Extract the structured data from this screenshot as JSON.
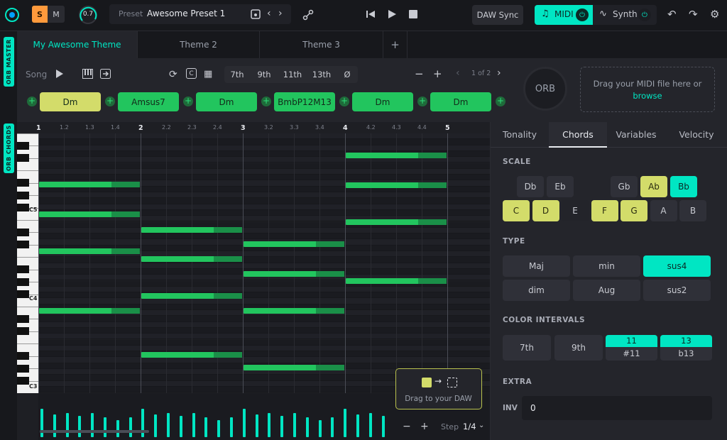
{
  "header": {
    "solo": "S",
    "mute": "M",
    "knob_value": "0.7",
    "preset_label": "Preset",
    "preset_name": "Awesome Preset 1",
    "daw_sync": "DAW Sync",
    "midi": "MIDI",
    "synth": "Synth"
  },
  "side": {
    "master": "ORB MASTER",
    "chords": "ORB CHORDS"
  },
  "tabs": [
    {
      "label": "My Awesome Theme"
    },
    {
      "label": "Theme 2"
    },
    {
      "label": "Theme 3"
    }
  ],
  "tab_add": "+",
  "song": {
    "label": "Song",
    "intervals": [
      "7th",
      "9th",
      "11th",
      "13th",
      "Ø"
    ],
    "page": "1 of 2",
    "minus": "−",
    "plus": "+"
  },
  "orb": {
    "label": "ORB",
    "drop_text": "Drag your MIDI file here or",
    "browse": "browse"
  },
  "chords": [
    {
      "name": "Dm",
      "color": "#d3dc6a"
    },
    {
      "name": "Amsus7",
      "color": "#22c55e"
    },
    {
      "name": "Dm",
      "color": "#22c55e"
    },
    {
      "name": "BmbP12M13",
      "color": "#22c55e"
    },
    {
      "name": "Dm",
      "color": "#22c55e"
    },
    {
      "name": "Dm",
      "color": "#22c55e"
    }
  ],
  "roll": {
    "beats": [
      "1",
      "1.2",
      "1.3",
      "1.4",
      "2",
      "2.2",
      "2.3",
      "2.4",
      "3",
      "3.2",
      "3.3",
      "3.4",
      "4",
      "4.2",
      "4.3",
      "4.4",
      "5"
    ],
    "octave_labels": [
      "C5",
      "C4",
      "C3"
    ],
    "drag_text": "Drag to your DAW",
    "step_label": "Step",
    "step_value": "1/4",
    "zoom_minus": "−",
    "zoom_plus": "+"
  },
  "panel": {
    "tabs": [
      "Tonality",
      "Chords",
      "Variables",
      "Velocity"
    ],
    "active_tab": "Chords",
    "scale_title": "SCALE",
    "scale_row1": [
      {
        "n": "Db",
        "s": "n"
      },
      {
        "n": "Eb",
        "s": "n"
      },
      {
        "n": "Gb",
        "s": "n"
      },
      {
        "n": "Ab",
        "s": "y"
      },
      {
        "n": "Bb",
        "s": "c"
      }
    ],
    "scale_row2": [
      {
        "n": "C",
        "s": "y"
      },
      {
        "n": "D",
        "s": "y"
      },
      {
        "n": "E",
        "s": "d"
      },
      {
        "n": "F",
        "s": "y"
      },
      {
        "n": "G",
        "s": "y"
      },
      {
        "n": "A",
        "s": "n"
      },
      {
        "n": "B",
        "s": "n"
      }
    ],
    "type_title": "TYPE",
    "types": [
      {
        "n": "Maj",
        "s": "n"
      },
      {
        "n": "min",
        "s": "n"
      },
      {
        "n": "sus4",
        "s": "c"
      },
      {
        "n": "dim",
        "s": "n"
      },
      {
        "n": "Aug",
        "s": "n"
      },
      {
        "n": "sus2",
        "s": "n"
      }
    ],
    "color_title": "COLOR INTERVALS",
    "colors": [
      {
        "n": "7th"
      },
      {
        "n": "9th"
      },
      {
        "n": "11",
        "sub": "#11"
      },
      {
        "n": "13",
        "sub": "b13"
      }
    ],
    "extra_title": "EXTRA",
    "inv_label": "INV",
    "inv_value": "0"
  },
  "colors": {
    "accent": "#00e6c3",
    "chord_yellow": "#d3dc6a",
    "note_green": "#22c55e",
    "knob": "#00e6c3"
  }
}
